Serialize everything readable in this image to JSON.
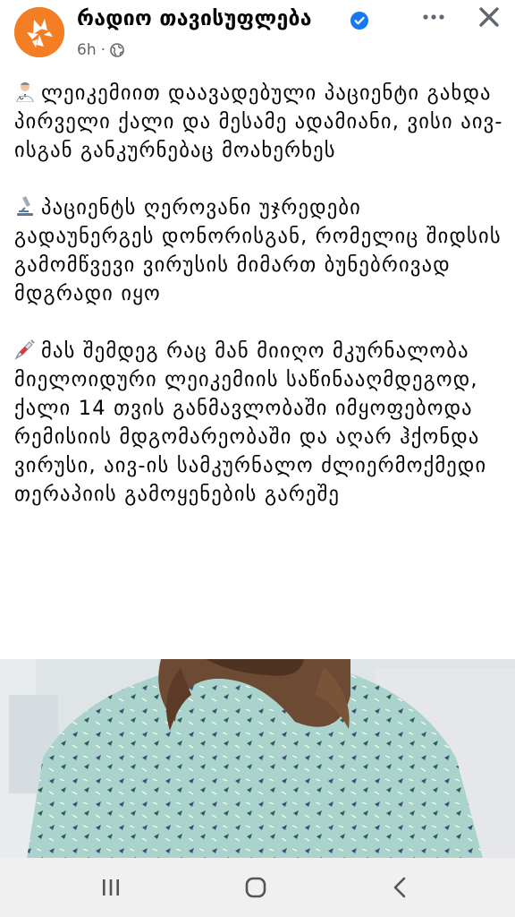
{
  "header": {
    "page_name": "რადიო თავისუფლება",
    "time": "6h",
    "separator": "·",
    "icons": [
      "rfe-logo",
      "verified-badge-icon",
      "globe-icon",
      "more-icon",
      "close-icon"
    ],
    "colors": {
      "brand": "#f47e24",
      "verified": "#1877f2",
      "meta": "#65676b"
    }
  },
  "post": {
    "paragraphs": [
      {
        "emoji": "doctor-emoji",
        "text": "ლეიკემიით დაავადებული პაციენტი გახდა პირველი ქალი და მესამე ადამიანი, ვისი აივ-ისგან განკურნებაც მოახერხეს"
      },
      {
        "emoji": "microscope-emoji",
        "text": "პაციენტს ღეროვანი უჯრედები გადაუნერგეს დონორისგან, რომელიც შიდსის გამომწვევი ვირუსის მიმართ ბუნებრივად მდგრადი იყო"
      },
      {
        "emoji": "syringe-emoji",
        "text": "მას შემდეგ რაც მან მიიღო მკურნალობა მიელოიდური ლეიკემიის საწინააღმდეგოდ, ქალი 14 თვის განმავლობაში იმყოფებოდა რემისიის მდგომარეობაში და აღარ ჰქონდა ვირუსი, აივ-ის სამკურნალო ძლიერმოქმედი თერაპიის გამოყენების გარეშე"
      }
    ]
  },
  "navbar": {
    "icons": [
      "recent-apps-icon",
      "home-icon",
      "back-icon"
    ],
    "background": "#f0f0f0"
  }
}
